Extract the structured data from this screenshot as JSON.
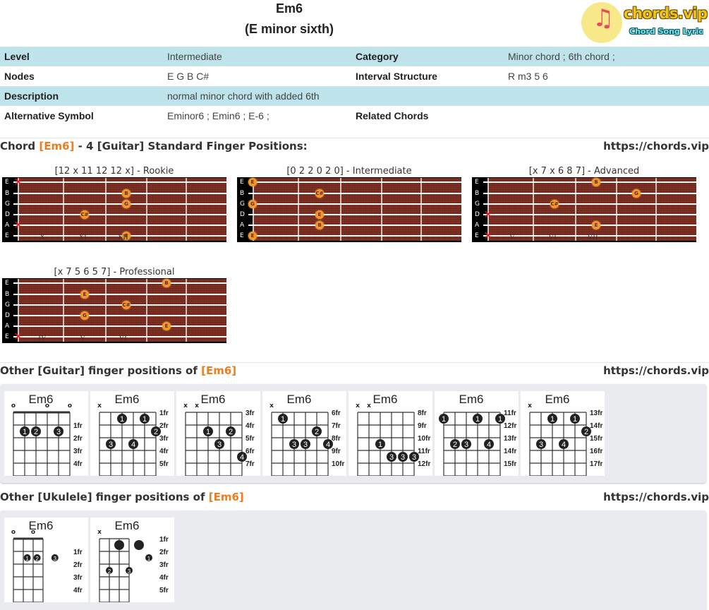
{
  "header": {
    "chord": "Em6",
    "full_name": "(E minor sixth)",
    "logo": {
      "name": "chords.vip",
      "tagline": "Chord Song Lyric"
    }
  },
  "info": {
    "rows": [
      {
        "k1": "Level",
        "v1": "Intermediate",
        "k2": "Category",
        "v2": "Minor chord ; 6th chord ;"
      },
      {
        "k1": "Nodes",
        "v1": "E G B C#",
        "k2": "Interval Structure",
        "v2": "R m3 5 6"
      },
      {
        "k1": "Description",
        "v1": "normal minor chord with added 6th",
        "k2": "",
        "v2": ""
      },
      {
        "k1": "Alternative Symbol",
        "v1": " Eminor6 ; Emin6 ; E-6 ;",
        "k2": "Related Chords",
        "v2": ""
      }
    ]
  },
  "standard": {
    "title_prefix": "Chord ",
    "title_chord": "[Em6]",
    "title_suffix": " - 4 [Guitar] Standard Finger Positions:",
    "link": "https://chords.vip",
    "string_labels": [
      "E",
      "B",
      "G",
      "D",
      "A",
      "E"
    ],
    "boards": [
      {
        "caption": "[12 x 11 12 12 x] - Rookie",
        "romans": [
          "X",
          "XI",
          "XII"
        ],
        "muted": [
          0,
          4
        ],
        "notes": [
          {
            "string": 1,
            "fret": 3,
            "label": "B"
          },
          {
            "string": 2,
            "fret": 3,
            "label": "G"
          },
          {
            "string": 3,
            "fret": 2,
            "label": "C#"
          },
          {
            "string": 5,
            "fret": 3,
            "label": "E"
          }
        ]
      },
      {
        "caption": "[0 2 2 0 2 0] - Intermediate",
        "romans": [],
        "muted": [],
        "notes": [
          {
            "string": 0,
            "fret": 0,
            "label": "E"
          },
          {
            "string": 1,
            "fret": 2,
            "label": "C#"
          },
          {
            "string": 2,
            "fret": 0,
            "label": "G"
          },
          {
            "string": 3,
            "fret": 2,
            "label": "E"
          },
          {
            "string": 4,
            "fret": 2,
            "label": "B"
          },
          {
            "string": 5,
            "fret": 0,
            "label": "E"
          }
        ]
      },
      {
        "caption": "[x 7 x 6 8 7] - Advanced",
        "romans": [
          "V",
          "VI",
          "VII"
        ],
        "muted": [
          3,
          5
        ],
        "notes": [
          {
            "string": 0,
            "fret": 3,
            "label": "B"
          },
          {
            "string": 1,
            "fret": 4,
            "label": "G"
          },
          {
            "string": 2,
            "fret": 2,
            "label": "C#"
          },
          {
            "string": 4,
            "fret": 3,
            "label": "E"
          }
        ]
      },
      {
        "caption": "[x 7 5 6 5 7] - Professional",
        "romans": [
          "IV",
          "V",
          "VI"
        ],
        "muted": [
          5
        ],
        "notes": [
          {
            "string": 0,
            "fret": 4,
            "label": "B"
          },
          {
            "string": 1,
            "fret": 2,
            "label": "E"
          },
          {
            "string": 2,
            "fret": 3,
            "label": "C#"
          },
          {
            "string": 3,
            "fret": 2,
            "label": "G"
          },
          {
            "string": 4,
            "fret": 4,
            "label": "E"
          }
        ]
      }
    ]
  },
  "guitar_other": {
    "title_prefix": "Other [Guitar] finger positions of ",
    "title_chord": "[Em6]",
    "link": "https://chords.vip",
    "charts": [
      {
        "name": "Em6",
        "top": [
          "o",
          "",
          "",
          "o",
          "",
          "o"
        ],
        "nut": true,
        "frets": [
          "1fr",
          "2fr",
          "3fr",
          "4fr"
        ],
        "fret_label_offset": 1,
        "dots": [
          {
            "s": 1,
            "f": 2,
            "n": "1"
          },
          {
            "s": 2,
            "f": 2,
            "n": "2"
          },
          {
            "s": 4,
            "f": 2,
            "n": "3"
          }
        ]
      },
      {
        "name": "Em6",
        "top": [
          "x",
          "",
          "",
          "",
          "",
          ""
        ],
        "nut": false,
        "frets": [
          "1fr",
          "2fr",
          "3fr",
          "4fr",
          "5fr"
        ],
        "fret_label_offset": 0,
        "dots": [
          {
            "s": 2,
            "f": 1,
            "n": "1"
          },
          {
            "s": 4,
            "f": 1,
            "n": "1"
          },
          {
            "s": 5,
            "f": 2,
            "n": "2"
          },
          {
            "s": 1,
            "f": 3,
            "n": "3"
          },
          {
            "s": 3,
            "f": 3,
            "n": "4"
          }
        ]
      },
      {
        "name": "Em6",
        "top": [
          "x",
          "x",
          "",
          "",
          "",
          ""
        ],
        "nut": false,
        "frets": [
          "3fr",
          "4fr",
          "5fr",
          "6fr",
          "7fr"
        ],
        "fret_label_offset": 0,
        "dots": [
          {
            "s": 2,
            "f": 2,
            "n": "1"
          },
          {
            "s": 4,
            "f": 2,
            "n": "2"
          },
          {
            "s": 3,
            "f": 3,
            "n": "3"
          },
          {
            "s": 5,
            "f": 4,
            "n": "4"
          }
        ]
      },
      {
        "name": "Em6",
        "top": [
          "x",
          "",
          "",
          "",
          "",
          ""
        ],
        "nut": false,
        "frets": [
          "6fr",
          "7fr",
          "8fr",
          "9fr",
          "10fr"
        ],
        "fret_label_offset": 0,
        "dots": [
          {
            "s": 1,
            "f": 1,
            "n": "1"
          },
          {
            "s": 4,
            "f": 2,
            "n": "2"
          },
          {
            "s": 2,
            "f": 3,
            "n": "3"
          },
          {
            "s": 3,
            "f": 3,
            "n": "3"
          },
          {
            "s": 5,
            "f": 3,
            "n": "4"
          }
        ]
      },
      {
        "name": "Em6",
        "top": [
          "x",
          "x",
          "",
          "",
          "",
          ""
        ],
        "nut": false,
        "frets": [
          "8fr",
          "9fr",
          "10fr",
          "11fr",
          "12fr"
        ],
        "fret_label_offset": 0,
        "dots": [
          {
            "s": 2,
            "f": 3,
            "n": "1"
          },
          {
            "s": 3,
            "f": 4,
            "n": "3"
          },
          {
            "s": 4,
            "f": 4,
            "n": "3"
          },
          {
            "s": 5,
            "f": 4,
            "n": "3"
          }
        ]
      },
      {
        "name": "Em6",
        "top": [
          "",
          "",
          "",
          "",
          "",
          ""
        ],
        "nut": false,
        "frets": [
          "11fr",
          "12fr",
          "13fr",
          "14fr",
          "15fr"
        ],
        "fret_label_offset": 0,
        "dots": [
          {
            "s": 0,
            "f": 1,
            "n": "1"
          },
          {
            "s": 3,
            "f": 1,
            "n": "1"
          },
          {
            "s": 5,
            "f": 1,
            "n": "1"
          },
          {
            "s": 1,
            "f": 3,
            "n": "2"
          },
          {
            "s": 2,
            "f": 3,
            "n": "3"
          },
          {
            "s": 4,
            "f": 3,
            "n": "4"
          }
        ]
      },
      {
        "name": "Em6",
        "top": [
          "x",
          "",
          "",
          "",
          "",
          ""
        ],
        "nut": false,
        "frets": [
          "13fr",
          "14fr",
          "15fr",
          "16fr",
          "17fr"
        ],
        "fret_label_offset": 0,
        "dots": [
          {
            "s": 2,
            "f": 1,
            "n": "1"
          },
          {
            "s": 4,
            "f": 1,
            "n": "1"
          },
          {
            "s": 5,
            "f": 2,
            "n": "2"
          },
          {
            "s": 1,
            "f": 3,
            "n": "3"
          },
          {
            "s": 3,
            "f": 3,
            "n": "4"
          }
        ]
      }
    ]
  },
  "ukulele_other": {
    "title_prefix": "Other [Ukulele] finger positions of ",
    "title_chord": "[Em6]",
    "link": "https://chords.vip",
    "charts": [
      {
        "name": "Em6",
        "top": [
          "o",
          "",
          "o",
          "",
          "o"
        ],
        "nut": true,
        "frets": [
          "1fr",
          "2fr",
          "3fr",
          "4fr"
        ],
        "fret_label_offset": 1,
        "dots": [
          {
            "s": 1.4,
            "f": 2,
            "n": "1",
            "glitch": true
          },
          {
            "s": 2.4,
            "f": 2,
            "n": "2",
            "glitch": true
          },
          {
            "s": 4.2,
            "f": 2,
            "n": "3",
            "glitch": true
          }
        ]
      },
      {
        "name": "Em6",
        "top": [
          "x",
          "",
          "",
          "",
          ""
        ],
        "nut": false,
        "frets": [
          "1fr",
          "2fr",
          "3fr",
          "4fr",
          "5fr"
        ],
        "fret_label_offset": 0,
        "dots": [
          {
            "s": 2,
            "f": 1,
            "n": ""
          },
          {
            "s": 4,
            "f": 1,
            "n": ""
          },
          {
            "s": 5,
            "f": 2,
            "n": "1",
            "glitch": true
          },
          {
            "s": 1,
            "f": 3,
            "n": "2",
            "glitch": true
          },
          {
            "s": 3,
            "f": 3,
            "n": "3",
            "glitch": true
          }
        ]
      }
    ]
  }
}
